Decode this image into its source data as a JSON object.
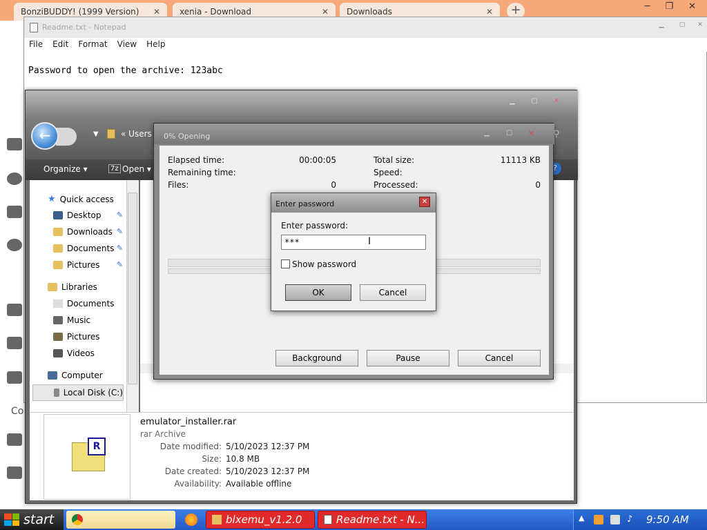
{
  "browser": {
    "tabs": [
      {
        "label": "BonziBUDDY! (1999 Version)",
        "close": "✕"
      },
      {
        "label": "xenia - Download",
        "close": "✕"
      },
      {
        "label": "Downloads",
        "close": "✕"
      }
    ],
    "new_tab": "+",
    "sidebar_label": "Co"
  },
  "notepad": {
    "title": "Readme.txt - Notepad",
    "menu": [
      "File",
      "Edit",
      "Format",
      "View",
      "Help"
    ],
    "content": "Password to open the archive: 123abc"
  },
  "explorer": {
    "breadcrumb": "« Users",
    "toolbar": {
      "organize": "Organize ▾",
      "open": "Open ▾"
    },
    "nav": {
      "quick_access": "Quick access",
      "desktop": "Desktop",
      "downloads": "Downloads",
      "documents": "Documents",
      "pictures": "Pictures",
      "libraries": "Libraries",
      "lib_documents": "Documents",
      "music": "Music",
      "lib_pictures": "Pictures",
      "videos": "Videos",
      "computer": "Computer",
      "local_disk": "Local Disk (C:)"
    },
    "details": {
      "filename": "emulator_installer.rar",
      "type": "rar Archive",
      "date_modified_label": "Date modified:",
      "date_modified": "5/10/2023 12:37 PM",
      "size_label": "Size:",
      "size": "10.8 MB",
      "date_created_label": "Date created:",
      "date_created": "5/10/2023 12:37 PM",
      "availability_label": "Availability:",
      "availability": "Available offline"
    }
  },
  "progress": {
    "title": "0% Opening",
    "elapsed_label": "Elapsed time:",
    "elapsed": "00:00:05",
    "remaining_label": "Remaining time:",
    "files_label": "Files:",
    "files": "0",
    "total_size_label": "Total size:",
    "total_size": "11113 KB",
    "speed_label": "Speed:",
    "processed_label": "Processed:",
    "processed": "0",
    "buttons": {
      "background": "Background",
      "pause": "Pause",
      "cancel": "Cancel"
    }
  },
  "password_dialog": {
    "title": "Enter password",
    "label": "Enter password:",
    "value": "***",
    "show_password": "Show password",
    "ok": "OK",
    "cancel": "Cancel"
  },
  "taskbar": {
    "start": "start",
    "tasks": [
      "blxemu_v1.2.0",
      "Readme.txt - N..."
    ],
    "clock": "9:50 AM"
  }
}
